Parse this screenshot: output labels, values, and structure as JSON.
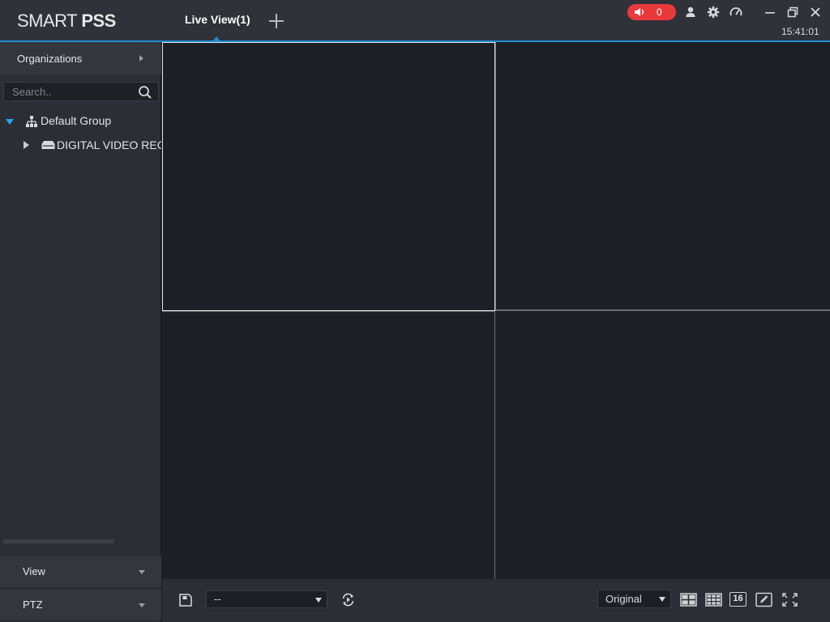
{
  "app": {
    "logo_light": "SMART ",
    "logo_bold": "PSS"
  },
  "tabs": [
    {
      "label": "Live View(1)",
      "active": true
    }
  ],
  "header": {
    "alarm_count": "0",
    "clock": "15:41:01",
    "icons": [
      "alarm-speaker-icon",
      "user-icon",
      "gear-icon",
      "speed-gauge-icon",
      "minimize-icon",
      "restore-icon",
      "close-icon"
    ]
  },
  "sidebar": {
    "organizations_label": "Organizations",
    "search": {
      "placeholder": "Search..",
      "value": ""
    },
    "tree": [
      {
        "label": "Default Group",
        "expanded": true,
        "level": 0
      },
      {
        "label": "DIGITAL VIDEO RECORDER",
        "expanded": false,
        "level": 1
      }
    ],
    "accordions": [
      {
        "label": "View"
      },
      {
        "label": "PTZ"
      }
    ]
  },
  "bottombar": {
    "view_select_value": "--",
    "ratio_select_value": "Original",
    "layout_16_label": "16"
  },
  "colors": {
    "accent": "#1e8fd6",
    "alarm": "#e8393b",
    "titlebar": "#2f3238",
    "panel": "#2b2e34",
    "video_cell": "#1c1f25"
  }
}
